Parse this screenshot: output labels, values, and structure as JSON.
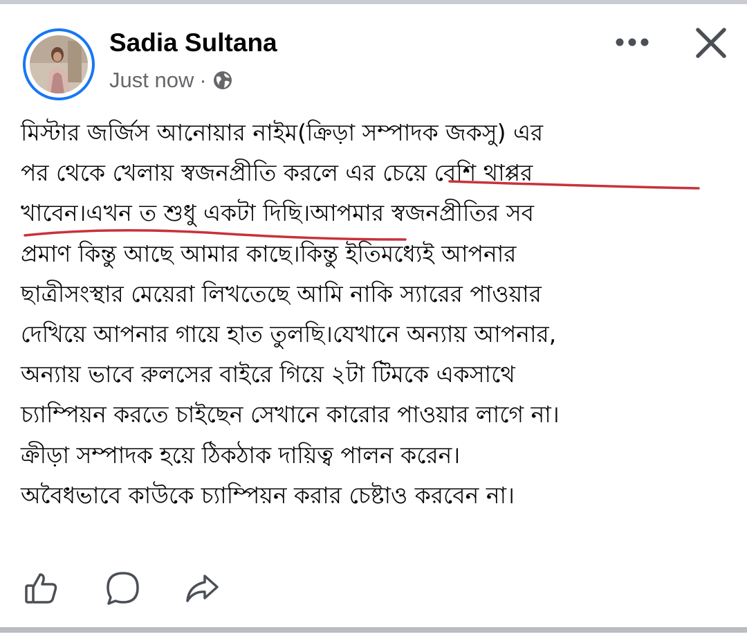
{
  "post": {
    "author": "Sadia Sultana",
    "timestamp": "Just now",
    "separator": "·",
    "audience_icon": "globe-icon",
    "lines": [
      "মিস্টার জর্জিস আনোয়ার নাইম(ক্রিড়া সম্পাদক জকসু) এর",
      "পর থেকে খেলায় স্বজনপ্রীতি করলে এর চেয়ে বেশি থাপ্পর",
      "খাবেন।এখন ত শুধু একটা দিছি।আপমার স্বজনপ্রীতির সব",
      "প্রমাণ কিন্তু আছে আমার কাছে।কিন্তু ইতিমধ্যেই আপনার",
      "ছাত্রীসংস্থার মেয়েরা লিখতেছে আমি নাকি স্যারের পাওয়ার",
      "দেখিয়ে আপনার গায়ে হাত তুলছি।যেখানে অন্যায় আপনার,",
      "অন্যায় ভাবে রুলসের বাইরে গিয়ে ২টা টিমকে একসাথে",
      "চ্যাম্পিয়ন করতে চাইছেন সেখানে কারোর পাওয়ার লাগে না।",
      "ক্রীড়া সম্পাদক হয়ে ঠিকঠাক দায়িত্ব পালন করেন।",
      "অবৈধভাবে কাউকে চ্যাম্পিয়ন করার চেষ্টাও করবেন না।"
    ]
  },
  "header_actions": {
    "more_icon": "more-horizontal-icon",
    "close_icon": "close-icon"
  },
  "action_bar": {
    "like_icon": "like-icon",
    "comment_icon": "comment-icon",
    "share_icon": "share-icon"
  },
  "colors": {
    "accent": "#1877f2",
    "text": "#050505",
    "meta": "#65676b",
    "annotation": "#c8323a",
    "icon": "#4b4f56"
  }
}
